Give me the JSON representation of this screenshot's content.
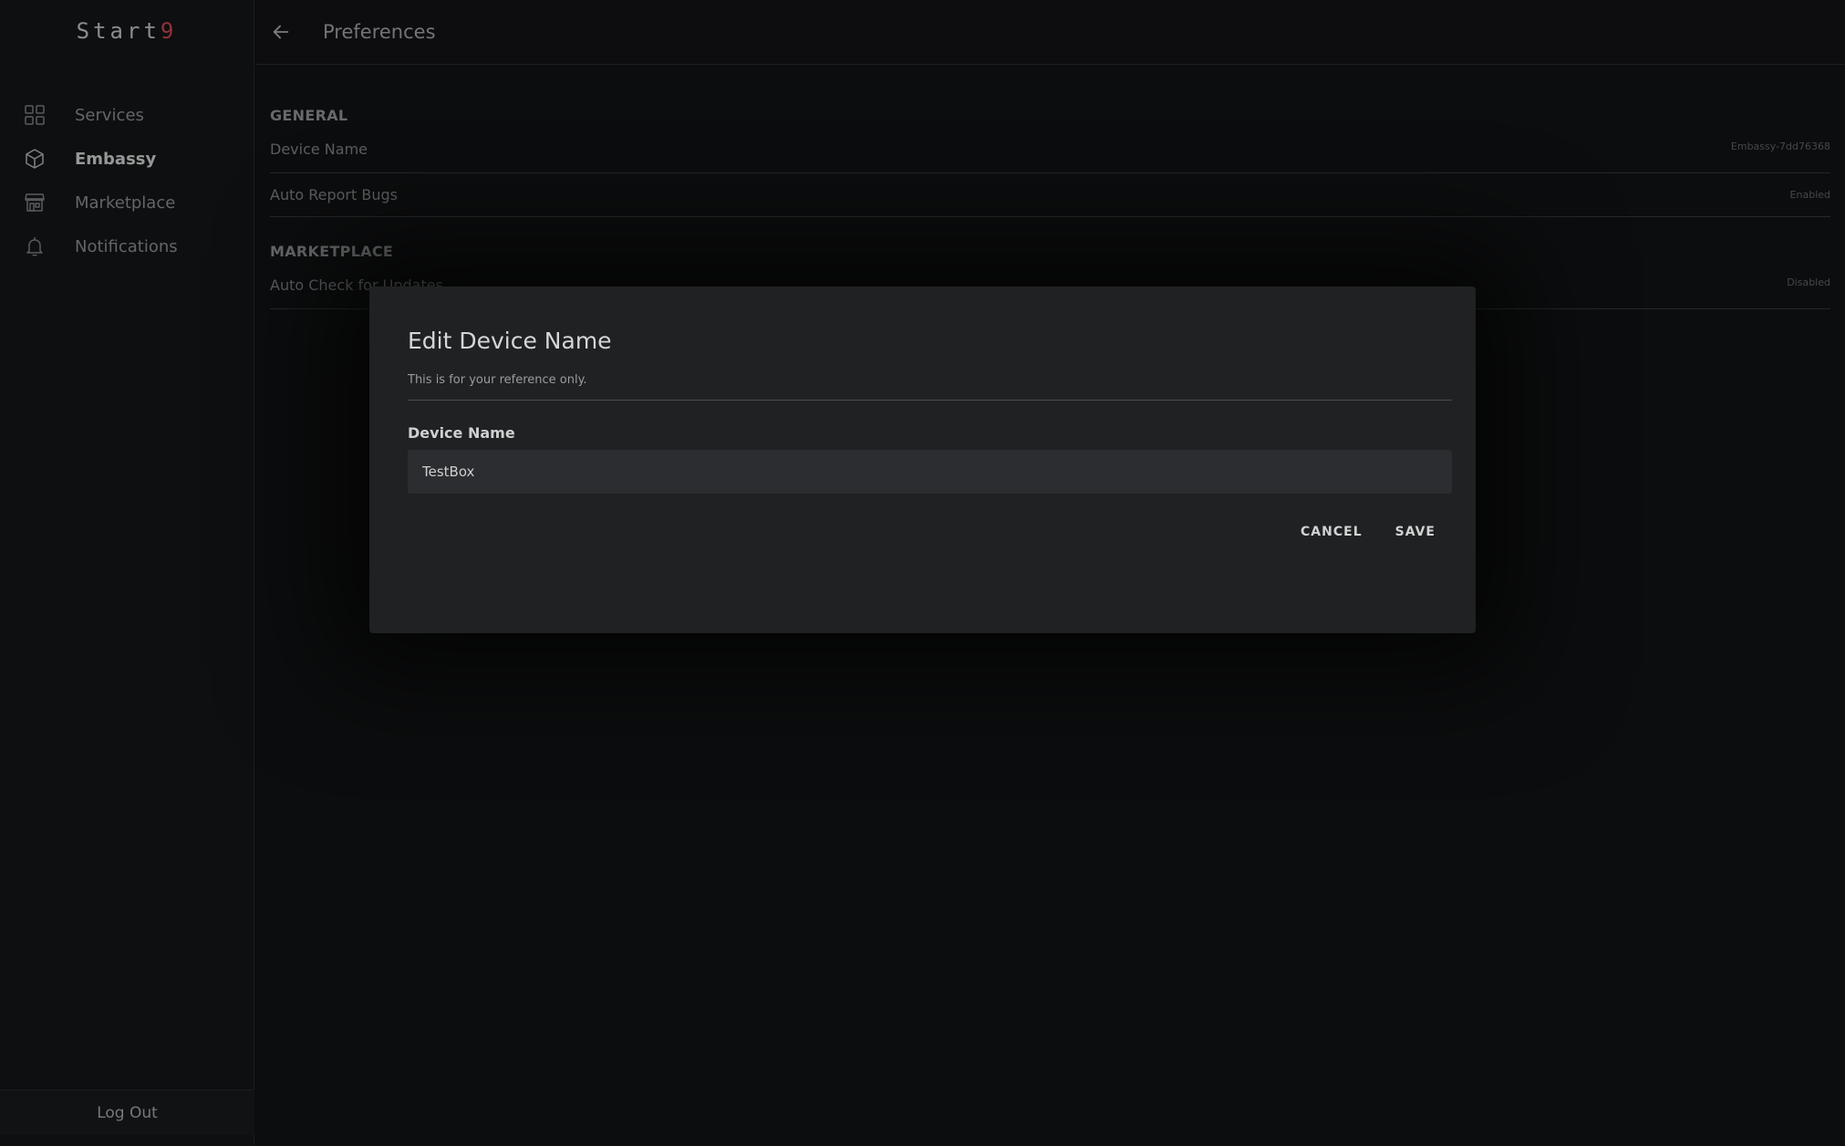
{
  "sidebar": {
    "logo": {
      "text": "Start",
      "accent": "9"
    },
    "items": [
      {
        "label": "Services",
        "icon": "grid-icon",
        "active": false
      },
      {
        "label": "Embassy",
        "icon": "cube-icon",
        "active": true
      },
      {
        "label": "Marketplace",
        "icon": "storefront-icon",
        "active": false
      },
      {
        "label": "Notifications",
        "icon": "bell-icon",
        "active": false
      }
    ],
    "logout_label": "Log Out"
  },
  "header": {
    "title": "Preferences"
  },
  "preferences": {
    "general": {
      "title": "GENERAL",
      "rows": [
        {
          "label": "Device Name",
          "value": "Embassy-7dd76368"
        },
        {
          "label": "Auto Report Bugs",
          "value": "Enabled"
        }
      ]
    },
    "marketplace": {
      "title": "MARKETPLACE",
      "rows": [
        {
          "label": "Auto Check for Updates",
          "value": "Disabled"
        }
      ]
    }
  },
  "modal": {
    "title": "Edit Device Name",
    "subtitle": "This is for your reference only.",
    "field_label": "Device Name",
    "field_value": "TestBox",
    "cancel_label": "CANCEL",
    "save_label": "SAVE"
  },
  "colors": {
    "background": "#131416",
    "sidebar": "#161819",
    "modal": "#1f2123",
    "logo_accent": "#e04b5a"
  }
}
